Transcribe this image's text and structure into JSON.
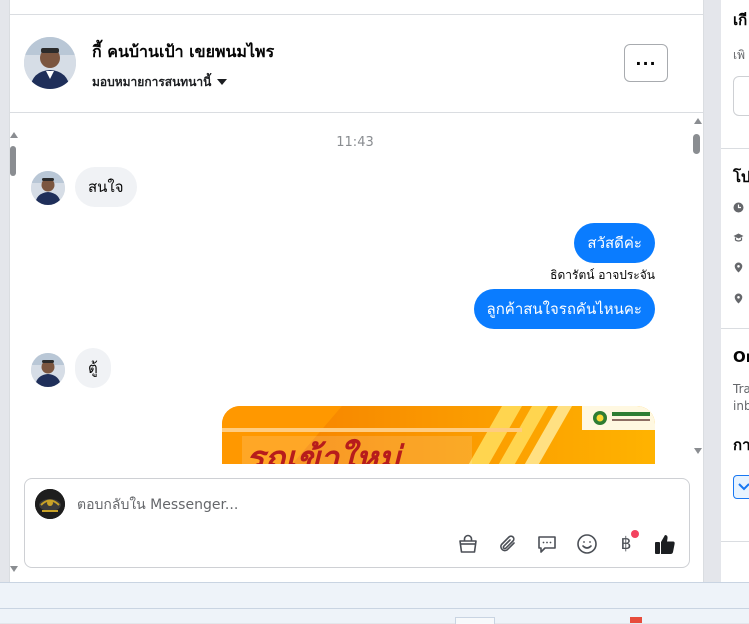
{
  "header": {
    "contact_name": "กี้ คนบ้านเป้า เขยพนมไพร",
    "assign_label": "มอบหมายการสนทนานี้",
    "more_label": "···"
  },
  "conversation": {
    "timestamp": "11:43",
    "messages": [
      {
        "direction": "incoming",
        "text": "สนใจ"
      },
      {
        "direction": "outgoing",
        "text": "สวัสดีค่ะ"
      },
      {
        "direction": "outgoing",
        "sender": "ธิดารัตน์ อาจประจัน",
        "text": "ลูกค้าสนใจรถคันไหนคะ"
      },
      {
        "direction": "incoming",
        "text": "ตู้"
      }
    ],
    "attachment_text": "รถเข้าใหม่"
  },
  "composer": {
    "placeholder": "ตอบกลับใน Messenger...",
    "baht_symbol": "฿",
    "tools": [
      "bag-icon",
      "paperclip-icon",
      "saved-replies-icon",
      "emoji-icon",
      "payment-icon",
      "thumbs-up-icon"
    ]
  },
  "right_panel": {
    "header_fragment": "เกี",
    "sub_fragment": "เพิ",
    "section2_title_fragment": "โป",
    "section3_title_fragment": "Or",
    "section3_text_line1": "Tra",
    "section3_text_line2": "inb",
    "section4_title_fragment": "กา"
  },
  "colors": {
    "accent": "#0a7cff",
    "incoming_bubble": "#f0f2f5",
    "icon": "#4b4f56",
    "notification": "#f3425f"
  }
}
